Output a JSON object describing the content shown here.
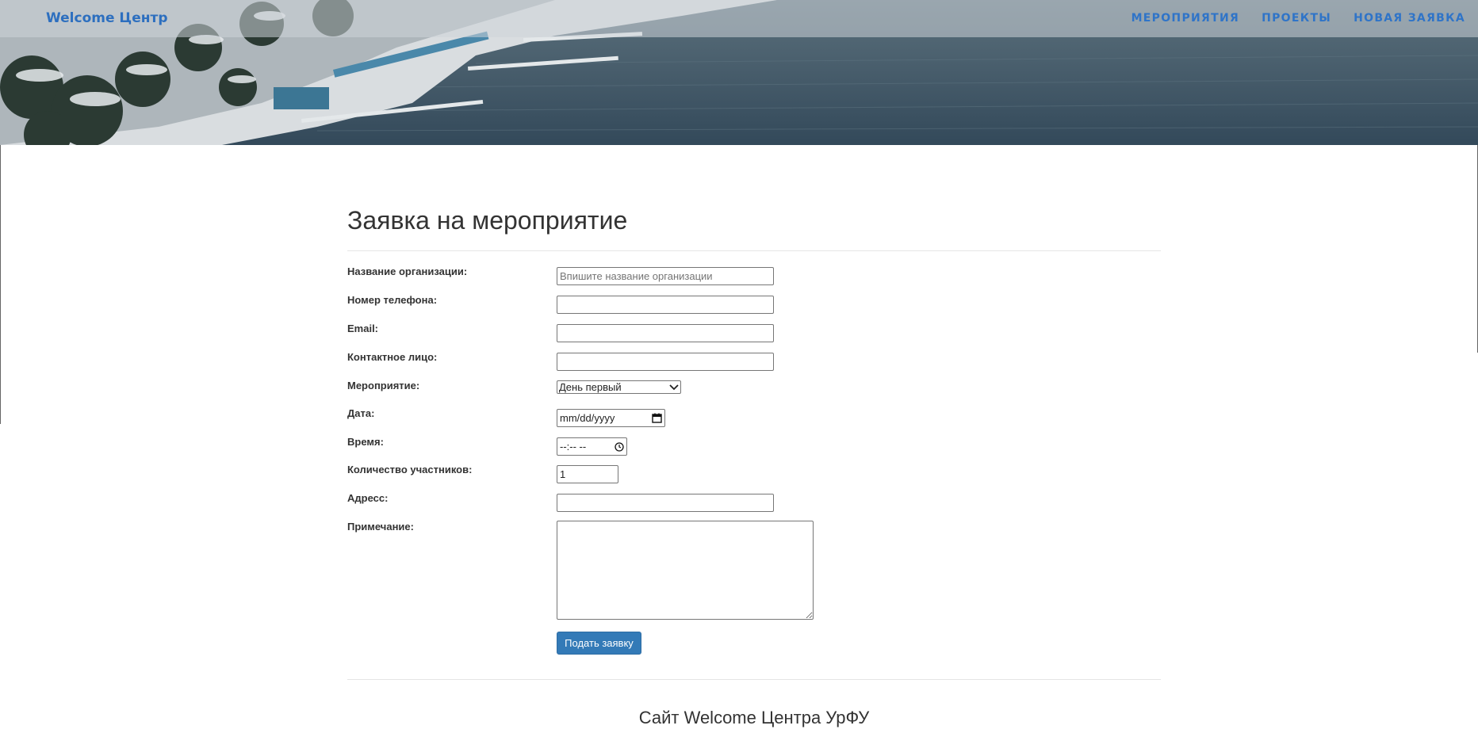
{
  "navbar": {
    "brand": "Welcome Центр",
    "links": [
      {
        "label": "МЕРОПРИЯТИЯ"
      },
      {
        "label": "ПРОЕКТЫ"
      },
      {
        "label": "НОВАЯ ЗАЯВКА"
      }
    ]
  },
  "form": {
    "title": "Заявка на мероприятие",
    "fields": {
      "organization": {
        "label": "Название организации:",
        "placeholder": "Впишите название организации",
        "value": ""
      },
      "phone": {
        "label": "Номер телефона:",
        "value": ""
      },
      "email": {
        "label": "Email:",
        "value": ""
      },
      "contact": {
        "label": "Контактное лицо:",
        "value": ""
      },
      "event": {
        "label": "Мероприятие:",
        "selected": "День первый"
      },
      "date": {
        "label": "Дата:",
        "value": "mm/dd/yyyy"
      },
      "time": {
        "label": "Время:",
        "value": "--:-- --"
      },
      "participants": {
        "label": "Количество участников:",
        "value": "1"
      },
      "address": {
        "label": "Адресс:",
        "value": ""
      },
      "note": {
        "label": "Примечание:",
        "value": ""
      }
    },
    "submit_label": "Подать заявку"
  },
  "footer": {
    "text": "Сайт Welcome Центра УрФУ"
  },
  "colors": {
    "accent": "#337ab7",
    "nav_link": "#2f74c8"
  }
}
